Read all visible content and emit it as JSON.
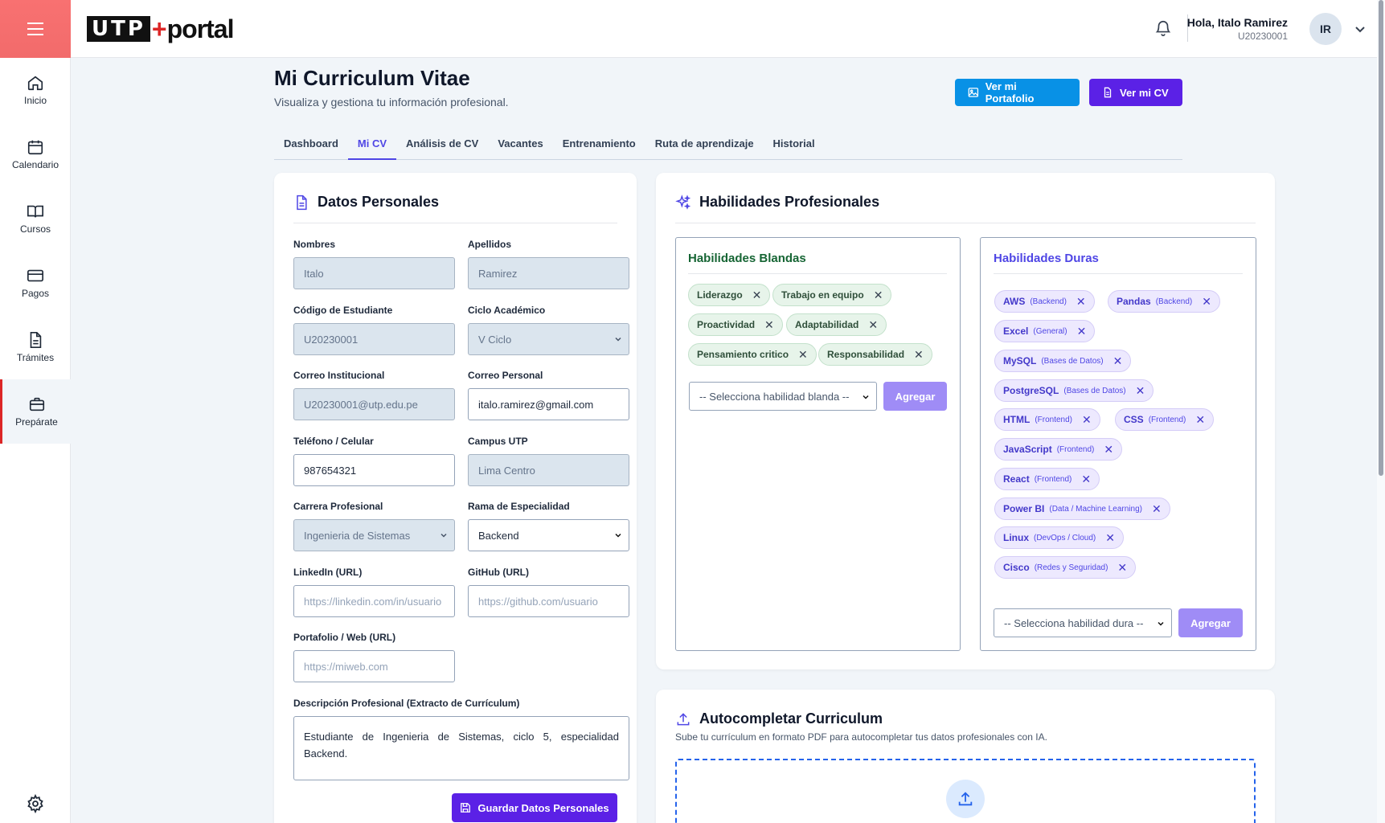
{
  "sidebar": {
    "menu_icon": "hamburger-icon",
    "items": [
      {
        "label": "Inicio",
        "icon": "home-icon"
      },
      {
        "label": "Calendario",
        "icon": "calendar-icon"
      },
      {
        "label": "Cursos",
        "icon": "book-icon"
      },
      {
        "label": "Pagos",
        "icon": "card-icon"
      },
      {
        "label": "Trámites",
        "icon": "document-icon"
      },
      {
        "label": "Prepárate",
        "icon": "briefcase-icon",
        "active": true
      }
    ],
    "settings_icon": "gear-icon"
  },
  "header": {
    "logo_box": "UTP",
    "logo_plus": "+",
    "logo_portal": "portal",
    "greeting": "Hola, Italo Ramirez",
    "user_code": "U20230001",
    "avatar_initials": "IR"
  },
  "page": {
    "title": "Mi Curriculum Vitae",
    "subtitle": "Visualiza y gestiona tu información profesional.",
    "portfolio_button": "Ver mi Portafolio",
    "cv_button": "Ver mi CV"
  },
  "tabs": [
    "Dashboard",
    "Mi CV",
    "Análisis de CV",
    "Vacantes",
    "Entrenamiento",
    "Ruta de aprendizaje",
    "Historial"
  ],
  "active_tab": "Mi CV",
  "personal": {
    "title": "Datos Personales",
    "nombres_label": "Nombres",
    "nombres_value": "Italo",
    "apellidos_label": "Apellidos",
    "apellidos_value": "Ramirez",
    "codigo_label": "Código de Estudiante",
    "codigo_value": "U20230001",
    "ciclo_label": "Ciclo Académico",
    "ciclo_value": "V Ciclo",
    "correo_inst_label": "Correo Institucional",
    "correo_inst_value": "U20230001@utp.edu.pe",
    "correo_pers_label": "Correo Personal",
    "correo_pers_value": "italo.ramirez@gmail.com",
    "telefono_label": "Teléfono / Celular",
    "telefono_value": "987654321",
    "campus_label": "Campus UTP",
    "campus_value": "Lima Centro",
    "carrera_label": "Carrera Profesional",
    "carrera_value": "Ingenieria de Sistemas",
    "rama_label": "Rama de Especialidad",
    "rama_value": "Backend",
    "linkedin_label": "LinkedIn (URL)",
    "linkedin_placeholder": "https://linkedin.com/in/usuario",
    "github_label": "GitHub (URL)",
    "github_placeholder": "https://github.com/usuario",
    "portfolio_label": "Portafolio / Web (URL)",
    "portfolio_placeholder": "https://miweb.com",
    "desc_label": "Descripción Profesional (Extracto de Currículum)",
    "desc_value": "Estudiante de Ingenieria de Sistemas, ciclo 5, especialidad Backend.",
    "save_button": "Guardar Datos Personales"
  },
  "skills": {
    "title": "Habilidades Profesionales",
    "soft_title": "Habilidades Blandas",
    "soft": [
      "Liderazgo",
      "Trabajo en equipo",
      "Proactividad",
      "Adaptabilidad",
      "Pensamiento critico",
      "Responsabilidad"
    ],
    "soft_select": "-- Selecciona habilidad blanda --",
    "soft_add": "Agregar",
    "hard_title": "Habilidades Duras",
    "hard": [
      {
        "name": "AWS",
        "cat": "(Backend)"
      },
      {
        "name": "Pandas",
        "cat": "(Backend)"
      },
      {
        "name": "Excel",
        "cat": "(General)"
      },
      {
        "name": "MySQL",
        "cat": "(Bases de Datos)"
      },
      {
        "name": "PostgreSQL",
        "cat": "(Bases de Datos)"
      },
      {
        "name": "HTML",
        "cat": "(Frontend)"
      },
      {
        "name": "CSS",
        "cat": "(Frontend)"
      },
      {
        "name": "JavaScript",
        "cat": "(Frontend)"
      },
      {
        "name": "React",
        "cat": "(Frontend)"
      },
      {
        "name": "Power BI",
        "cat": "(Data / Machine Learning)"
      },
      {
        "name": "Linux",
        "cat": "(DevOps / Cloud)"
      },
      {
        "name": "Cisco",
        "cat": "(Redes y Seguridad)"
      }
    ],
    "hard_select": "-- Selecciona habilidad dura --",
    "hard_add": "Agregar",
    "remove_glyph": "✕"
  },
  "autocomplete": {
    "title": "Autocompletar Curriculum",
    "subtitle": "Sube tu currículum en formato PDF para autocompletar tus datos profesionales con IA.",
    "upload_icon": "upload-icon"
  },
  "colors": {
    "accent_purple": "#5b21e6",
    "accent_blue": "#0891e6",
    "sidebar_red": "#f26b6b",
    "soft_green": "#e7f4ea",
    "hard_lavender": "#ede9fe"
  }
}
